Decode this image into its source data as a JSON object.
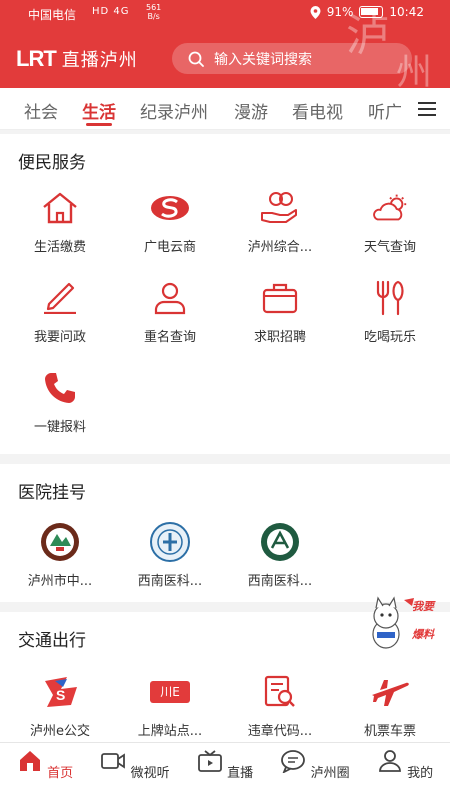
{
  "status_bar": {
    "carrier": "中国电信",
    "network": "HD 4G",
    "speed_value": "561",
    "speed_unit": "B/s",
    "battery": "91%",
    "time": "10:42"
  },
  "header": {
    "logo_mark": "LRT",
    "app_name": "直播泸州",
    "search_placeholder": "输入关键词搜索",
    "accent_color": "#e23b3b"
  },
  "tabs": [
    "社会",
    "生活",
    "纪录泸州",
    "漫游",
    "看电视",
    "听广"
  ],
  "active_tab": "生活",
  "sections": [
    {
      "title": "便民服务",
      "items": [
        {
          "label": "生活缴费",
          "icon": "house-icon"
        },
        {
          "label": "广电云商",
          "icon": "s-logo-icon"
        },
        {
          "label": "泸州综合...",
          "icon": "coin-hand-icon"
        },
        {
          "label": "天气查询",
          "icon": "weather-icon"
        },
        {
          "label": "我要问政",
          "icon": "pen-icon"
        },
        {
          "label": "重名查询",
          "icon": "person-icon"
        },
        {
          "label": "求职招聘",
          "icon": "briefcase-icon"
        },
        {
          "label": "吃喝玩乐",
          "icon": "utensils-icon"
        },
        {
          "label": "一键报料",
          "icon": "phone-icon"
        }
      ]
    },
    {
      "title": "医院挂号",
      "items": [
        {
          "label": "泸州市中...",
          "icon": "hospital-emblem-icon"
        },
        {
          "label": "西南医科...",
          "icon": "hospital-emblem-icon"
        },
        {
          "label": "西南医科...",
          "icon": "hospital-emblem-icon"
        }
      ]
    },
    {
      "title": "交通出行",
      "items": [
        {
          "label": "泸州e公交",
          "icon": "bus-logo-icon"
        },
        {
          "label": "上牌站点...",
          "icon": "license-plate-icon",
          "plate_text": "川E"
        },
        {
          "label": "违章代码...",
          "icon": "doc-search-icon"
        },
        {
          "label": "机票车票",
          "icon": "airplane-icon"
        }
      ]
    }
  ],
  "float_badge": {
    "text1": "我要",
    "text2": "爆料"
  },
  "bottom_nav": [
    {
      "label": "首页",
      "icon": "home-icon"
    },
    {
      "label": "微视听",
      "icon": "video-icon"
    },
    {
      "label": "直播",
      "icon": "tv-icon"
    },
    {
      "label": "泸州圈",
      "icon": "chat-icon"
    },
    {
      "label": "我的",
      "icon": "user-icon"
    }
  ]
}
